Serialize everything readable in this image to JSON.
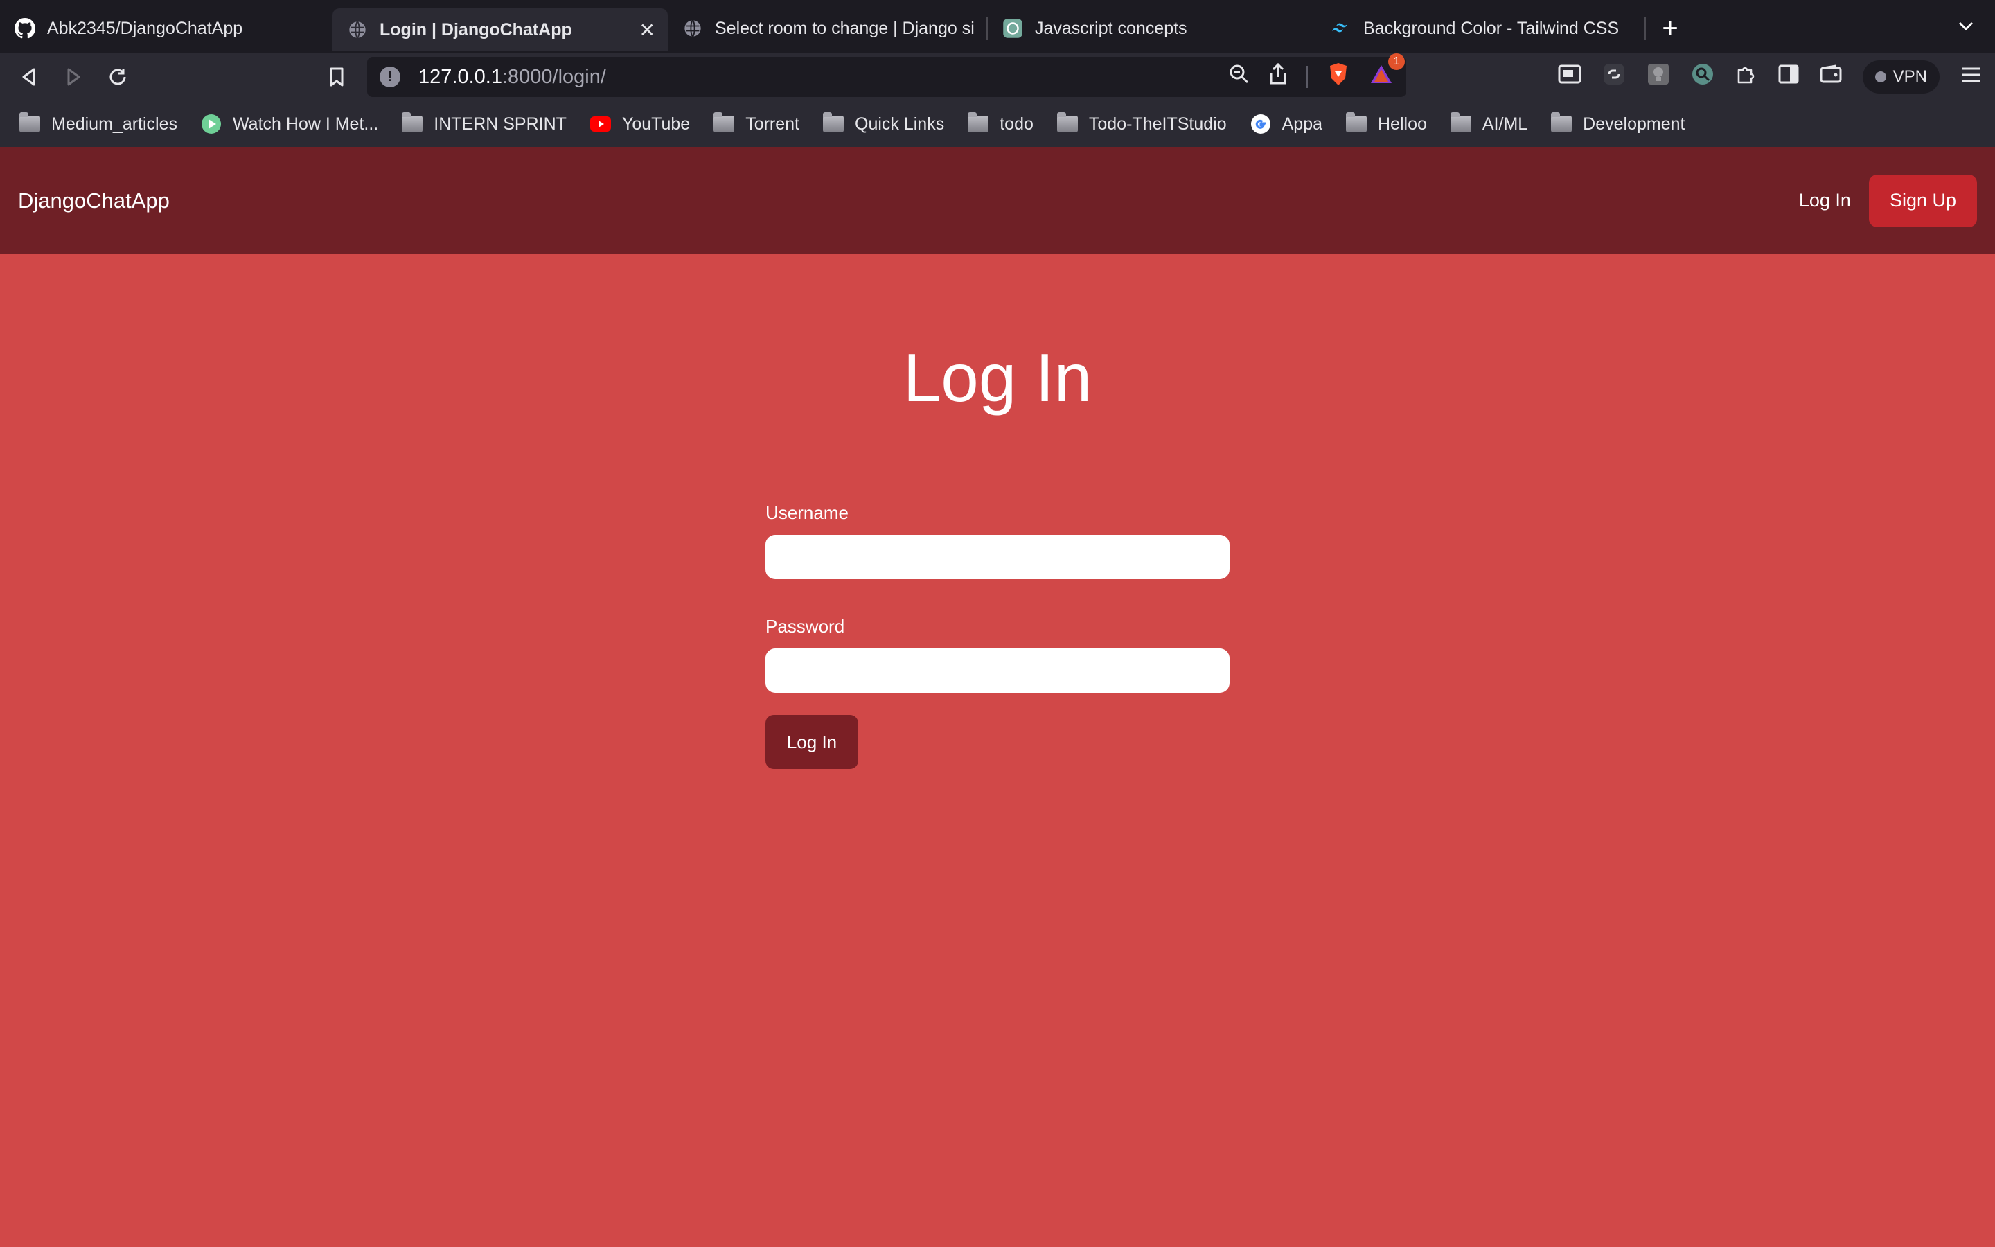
{
  "browser": {
    "tabs": [
      {
        "title": "Abk2345/DjangoChatApp",
        "icon": "github-icon",
        "active": false
      },
      {
        "title": "Login | DjangoChatApp",
        "icon": "globe-icon",
        "active": true
      },
      {
        "title": "Select room to change | Django site",
        "icon": "globe-icon",
        "active": false
      },
      {
        "title": "Javascript concepts",
        "icon": "chatgpt-icon",
        "active": false
      },
      {
        "title": "Background Color - Tailwind CSS",
        "icon": "tailwind-icon",
        "active": false
      }
    ],
    "new_tab": "+",
    "close_tab": "✕",
    "url_host": "127.0.0.1",
    "url_path": ":8000/login/",
    "brave_badge": "1",
    "vpn_label": "VPN",
    "bookmarks": [
      {
        "label": "Medium_articles",
        "icon": "folder-icon"
      },
      {
        "label": "Watch How I Met...",
        "icon": "play-icon"
      },
      {
        "label": "INTERN SPRINT",
        "icon": "folder-icon"
      },
      {
        "label": "YouTube",
        "icon": "youtube-icon"
      },
      {
        "label": "Torrent",
        "icon": "folder-icon"
      },
      {
        "label": "Quick Links",
        "icon": "folder-icon"
      },
      {
        "label": "todo",
        "icon": "folder-icon"
      },
      {
        "label": "Todo-TheITStudio",
        "icon": "folder-icon"
      },
      {
        "label": "Appa",
        "icon": "google-icon"
      },
      {
        "label": "Helloo",
        "icon": "folder-icon"
      },
      {
        "label": "AI/ML",
        "icon": "folder-icon"
      },
      {
        "label": "Development",
        "icon": "folder-icon"
      }
    ]
  },
  "site": {
    "brand": "DjangoChatApp",
    "nav_login": "Log In",
    "nav_signup": "Sign Up",
    "page_title": "Log In",
    "username_label": "Username",
    "username_value": "",
    "password_label": "Password",
    "password_value": "",
    "submit_label": "Log In"
  },
  "colors": {
    "page_bg": "#d14848",
    "header_bg": "#6f2026",
    "signup_bg": "#c4262d",
    "submit_bg": "#7b1f25"
  }
}
